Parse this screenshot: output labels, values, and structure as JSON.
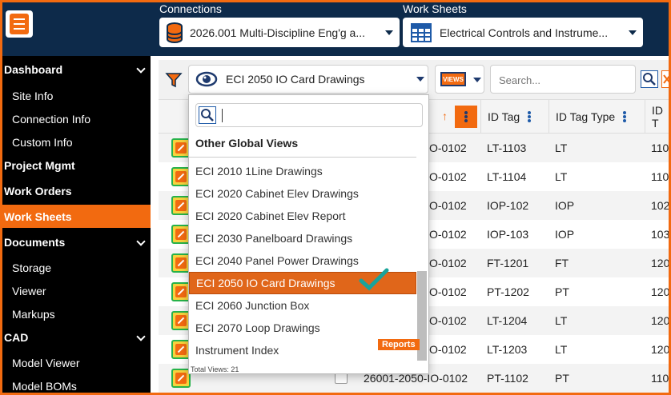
{
  "header": {
    "connections_label": "Connections",
    "connection_value": "2026.001 Multi-Discipline Eng'g a...",
    "worksheets_label": "Work Sheets",
    "worksheet_value": "Electrical Controls and Instrume..."
  },
  "sidebar": {
    "items": [
      {
        "label": "Dashboard",
        "type": "main",
        "expandable": true
      },
      {
        "label": "Site Info",
        "type": "sub"
      },
      {
        "label": "Connection Info",
        "type": "sub"
      },
      {
        "label": "Custom Info",
        "type": "sub"
      },
      {
        "label": "Project Mgmt",
        "type": "main"
      },
      {
        "label": "Work Orders",
        "type": "main"
      },
      {
        "label": "Work Sheets",
        "type": "main",
        "active": true
      },
      {
        "label": "Documents",
        "type": "main",
        "expandable": true
      },
      {
        "label": "Storage",
        "type": "sub"
      },
      {
        "label": "Viewer",
        "type": "sub"
      },
      {
        "label": "Markups",
        "type": "sub"
      },
      {
        "label": "CAD",
        "type": "main",
        "expandable": true
      },
      {
        "label": "Model Viewer",
        "type": "sub"
      },
      {
        "label": "Model BOMs",
        "type": "sub"
      }
    ]
  },
  "toolbar": {
    "view_value": "ECI 2050 IO Card Drawings",
    "views_badge": "VIEWS",
    "search_placeholder": "Search..."
  },
  "grid": {
    "columns": [
      "ID Tag",
      "ID Tag Type",
      "ID T"
    ],
    "rows": [
      {
        "drawing": "O-0102",
        "id_tag": "LT-1103",
        "id_tag_type": "LT",
        "id_t": "110"
      },
      {
        "drawing": "O-0102",
        "id_tag": "LT-1104",
        "id_tag_type": "LT",
        "id_t": "110"
      },
      {
        "drawing": "O-0102",
        "id_tag": "IOP-102",
        "id_tag_type": "IOP",
        "id_t": "102"
      },
      {
        "drawing": "O-0102",
        "id_tag": "IOP-103",
        "id_tag_type": "IOP",
        "id_t": "103"
      },
      {
        "drawing": "O-0102",
        "id_tag": "FT-1201",
        "id_tag_type": "FT",
        "id_t": "120"
      },
      {
        "drawing": "O-0102",
        "id_tag": "PT-1202",
        "id_tag_type": "PT",
        "id_t": "120"
      },
      {
        "drawing": "O-0102",
        "id_tag": "LT-1204",
        "id_tag_type": "LT",
        "id_t": "120"
      },
      {
        "drawing": "O-0102",
        "id_tag": "LT-1203",
        "id_tag_type": "LT",
        "id_t": "120"
      },
      {
        "drawing": "26001-2050-IO-0102",
        "id_tag": "PT-1102",
        "id_tag_type": "PT",
        "id_t": "110"
      }
    ]
  },
  "dropdown": {
    "section_title": "Other Global Views",
    "items": [
      "ECI 2010 1Line Drawings",
      "ECI 2020 Cabinet Elev Drawings",
      "ECI 2020 Cabinet Elev Report",
      "ECI 2030 Panelboard Drawings",
      "ECI 2040 Panel Power Drawings",
      "ECI 2050 IO Card Drawings",
      "ECI 2060 Junction Box",
      "ECI 2070 Loop Drawings",
      "Instrument Index"
    ],
    "selected_index": 5,
    "reports_badge": "Reports",
    "footer": "Total Views: 21"
  },
  "colors": {
    "accent": "#f26a10",
    "header_bg": "#0d2a4a",
    "sidebar_bg": "#000000",
    "check": "#1aa39a"
  }
}
